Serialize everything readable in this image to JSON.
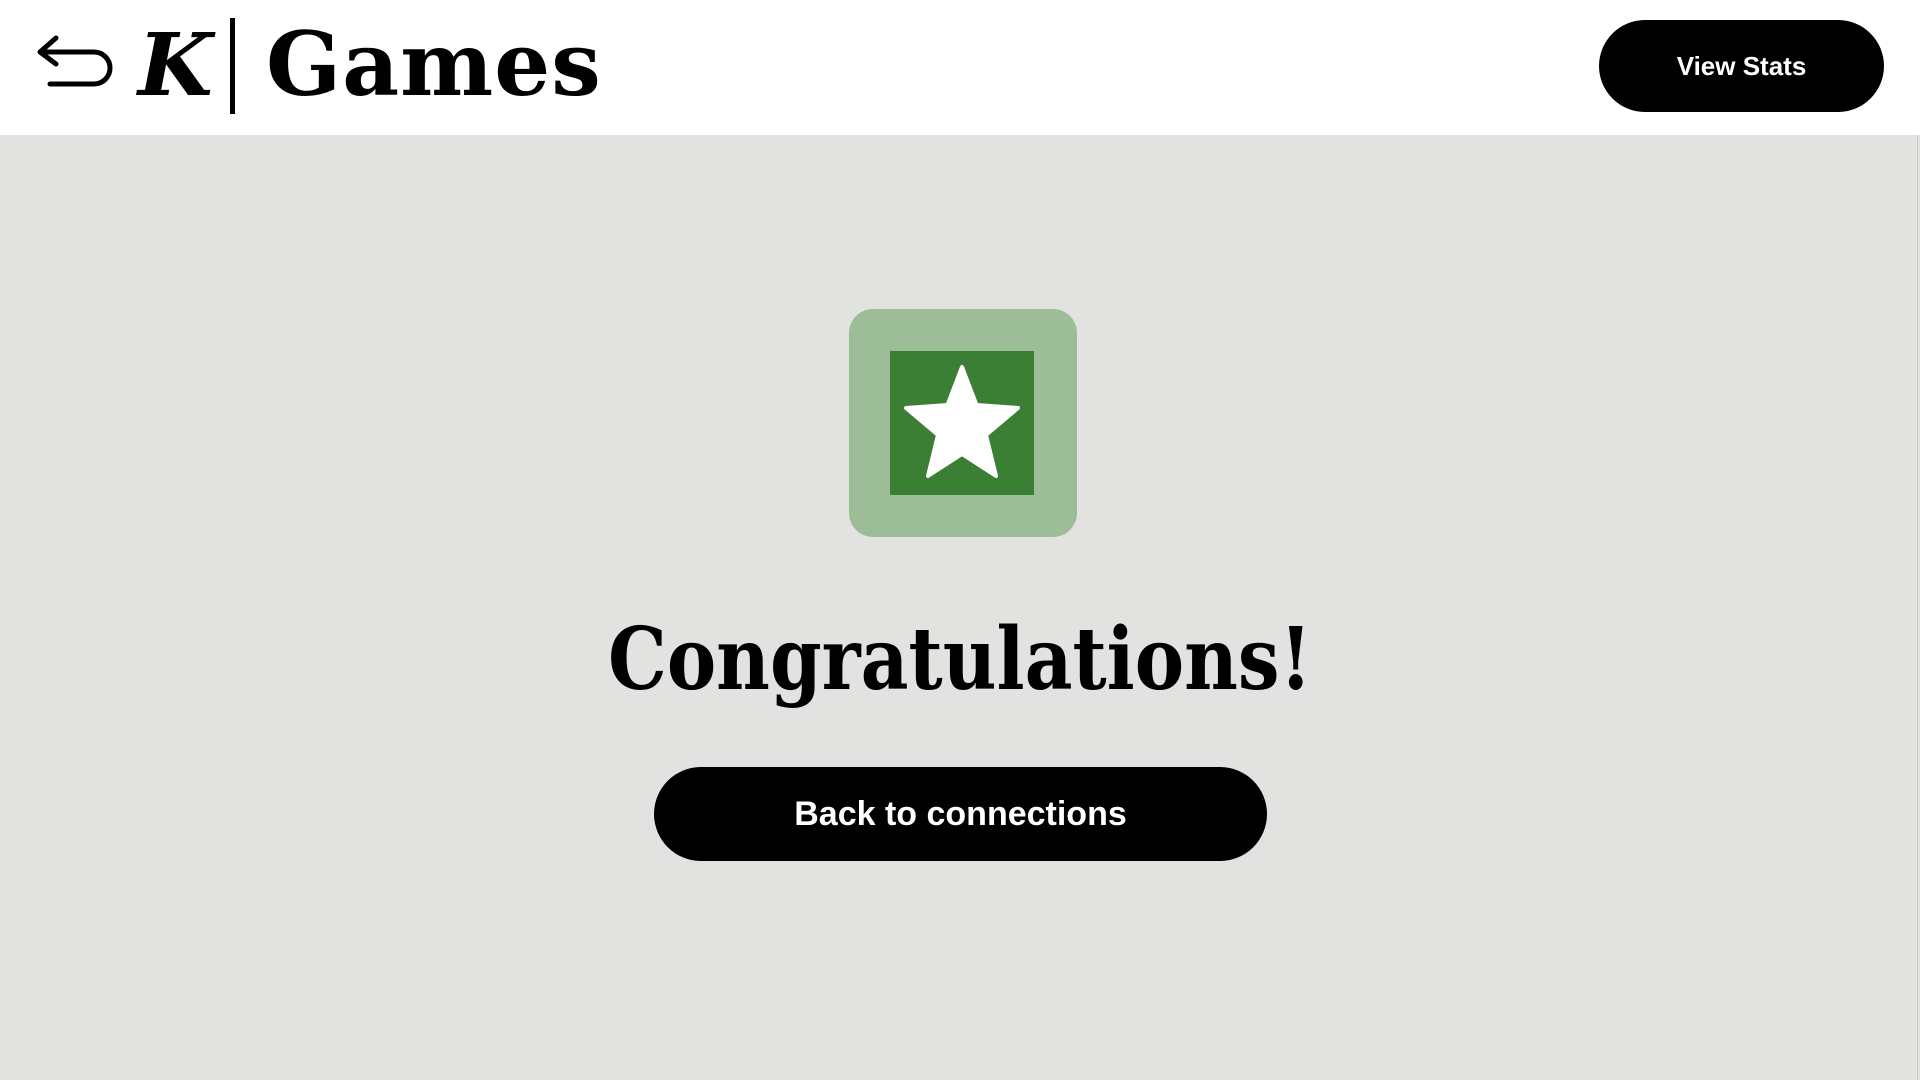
{
  "header": {
    "back_icon": "back-arrow-icon",
    "logo_mark": "K",
    "title": "Games",
    "view_stats_label": "View Stats"
  },
  "main": {
    "badge_icon": "star-icon",
    "heading": "Congratulations!",
    "back_button_label": "Back to connections"
  },
  "colors": {
    "page_background": "#e2e2e1",
    "header_background": "#ffffff",
    "badge_outer": "#9dbd98",
    "badge_inner": "#3a7f33",
    "button_background": "#000000",
    "button_text": "#ffffff"
  }
}
